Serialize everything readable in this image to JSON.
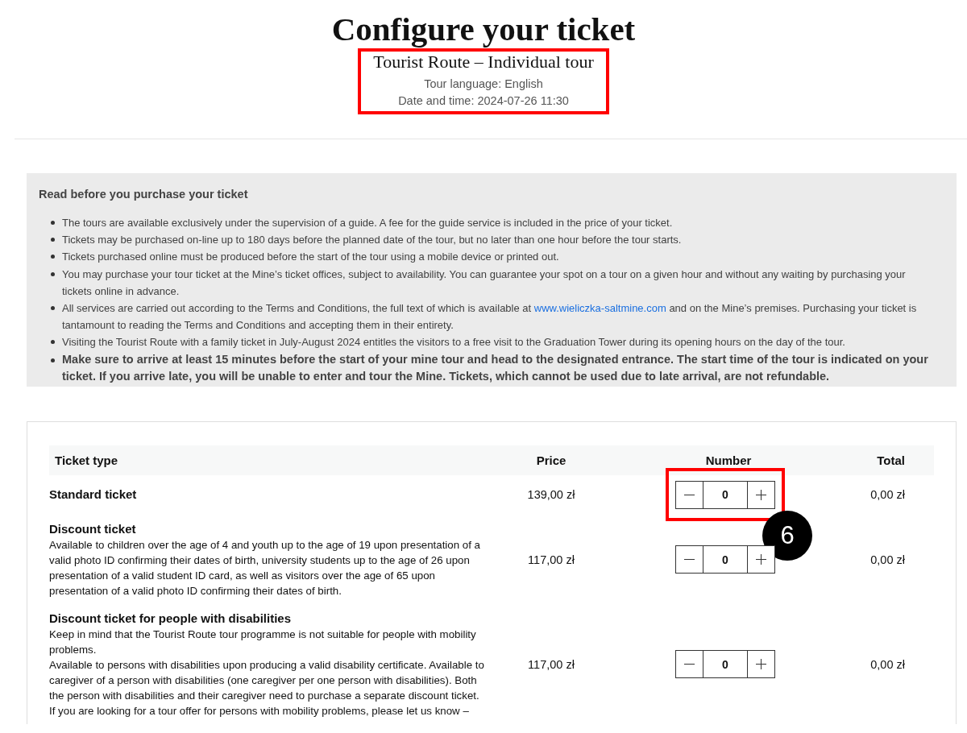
{
  "header": {
    "title": "Configure your ticket",
    "highlighted": true,
    "tour": "Tourist Route – Individual tour",
    "language": "Tour language: English",
    "datetime": "Date and time: 2024-07-26 11:30"
  },
  "notice": {
    "heading": "Read before you purchase your ticket",
    "items": [
      {
        "kind": "plain",
        "text": "The tours are available exclusively under the supervision of a guide. A fee for the guide service is included in the price of your ticket."
      },
      {
        "kind": "plain",
        "text": "Tickets may be purchased on-line up to 180 days before the planned date of the tour, but no later than one hour before the tour starts."
      },
      {
        "kind": "plain",
        "text": "Tickets purchased online must be produced before the start of the tour using a mobile device or printed out."
      },
      {
        "kind": "plain",
        "text": "You may purchase your tour ticket at the Mine’s ticket offices, subject to availability. You can guarantee your spot on a tour on a given hour and without any waiting by purchasing your tickets online in advance."
      },
      {
        "kind": "link",
        "before": "All services are carried out according to the Terms and Conditions, the full text of which is available at",
        "link": "www.wieliczka-saltmine.com",
        "after": "and on the Mine’s premises. Purchasing your ticket is tantamount to reading the Terms and Conditions and accepting them in their entirety."
      },
      {
        "kind": "plain",
        "text": "Visiting the Tourist Route with a family ticket in July-August 2024 entitles the visitors to a free visit to the Graduation Tower during its opening hours on the day of the tour."
      },
      {
        "kind": "important",
        "text": "Make sure to arrive at least 15 minutes before the start of your mine tour and head to the designated entrance. The start time of the tour is indicated on your ticket. If you arrive late, you will be unable to enter and tour the Mine. Tickets, which cannot be used due to late arrival, are not refundable."
      }
    ]
  },
  "tickets": {
    "columns": [
      "Ticket type",
      "Price",
      "Number",
      "Total"
    ],
    "rows": [
      {
        "name": "Standard ticket",
        "price": "139,00 zł",
        "quantity": "0",
        "total": "0,00 zł",
        "highlighted": true,
        "callout": "6"
      },
      {
        "name": "Discount ticket",
        "description": [
          "Available to children over the age of 4 and youth up to the age of 19 upon presentation of a valid photo ID confirming their dates of birth, university students up to the age of 26 upon presentation of a valid student ID card, as well as visitors over the age of 65 upon presentation of a valid photo ID confirming their dates of birth."
        ],
        "price": "117,00 zł",
        "quantity": "0",
        "total": "0,00 zł",
        "highlighted": false
      },
      {
        "name": "Discount ticket for people with disabilities",
        "description": [
          "Keep in mind that the Tourist Route tour programme is not suitable for people with mobility problems.",
          "Available to persons with disabilities upon producing a valid disability certificate. Available to caregiver of a person with disabilities (one caregiver per one person with disabilities). Both the person with disabilities and their caregiver need to purchase a separate discount ticket.",
          "If you are looking for a tour offer for persons with mobility problems, please let us know –"
        ],
        "price": "117,00 zł",
        "quantity": "0",
        "total": "0,00 zł",
        "highlighted": false
      }
    ]
  }
}
